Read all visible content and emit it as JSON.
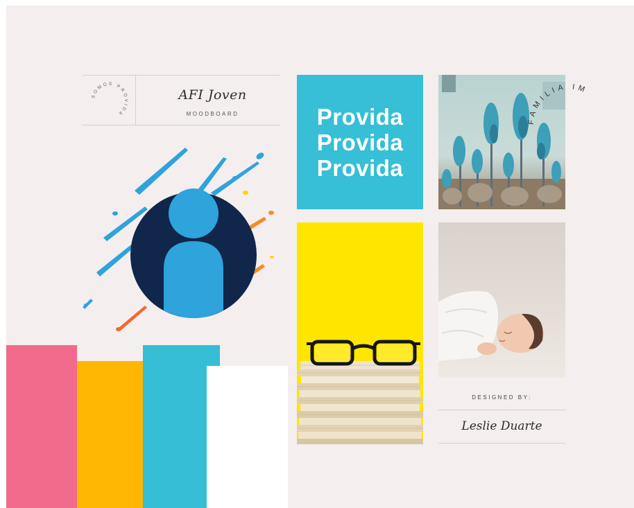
{
  "header": {
    "circle_text": "SOMOS PROVIDA",
    "title": "AFI Joven",
    "subtitle": "MOODBOARD"
  },
  "provida_tile": {
    "lines": [
      "Provida",
      "Provida",
      "Provida"
    ]
  },
  "arc_text": "FAMILIA IMPORTA",
  "credit": {
    "label": "DESIGNED BY:",
    "name": "Leslie Duarte"
  },
  "palette": [
    "#f26a8b",
    "#ffb703",
    "#35bed5",
    "#ffffff"
  ],
  "colors": {
    "background": "#f4eeee",
    "navy": "#10264a",
    "blue": "#2ea3dc",
    "orange": "#f28c28",
    "yellow": "#ffe500"
  },
  "icons": [
    "person-logo-icon"
  ]
}
